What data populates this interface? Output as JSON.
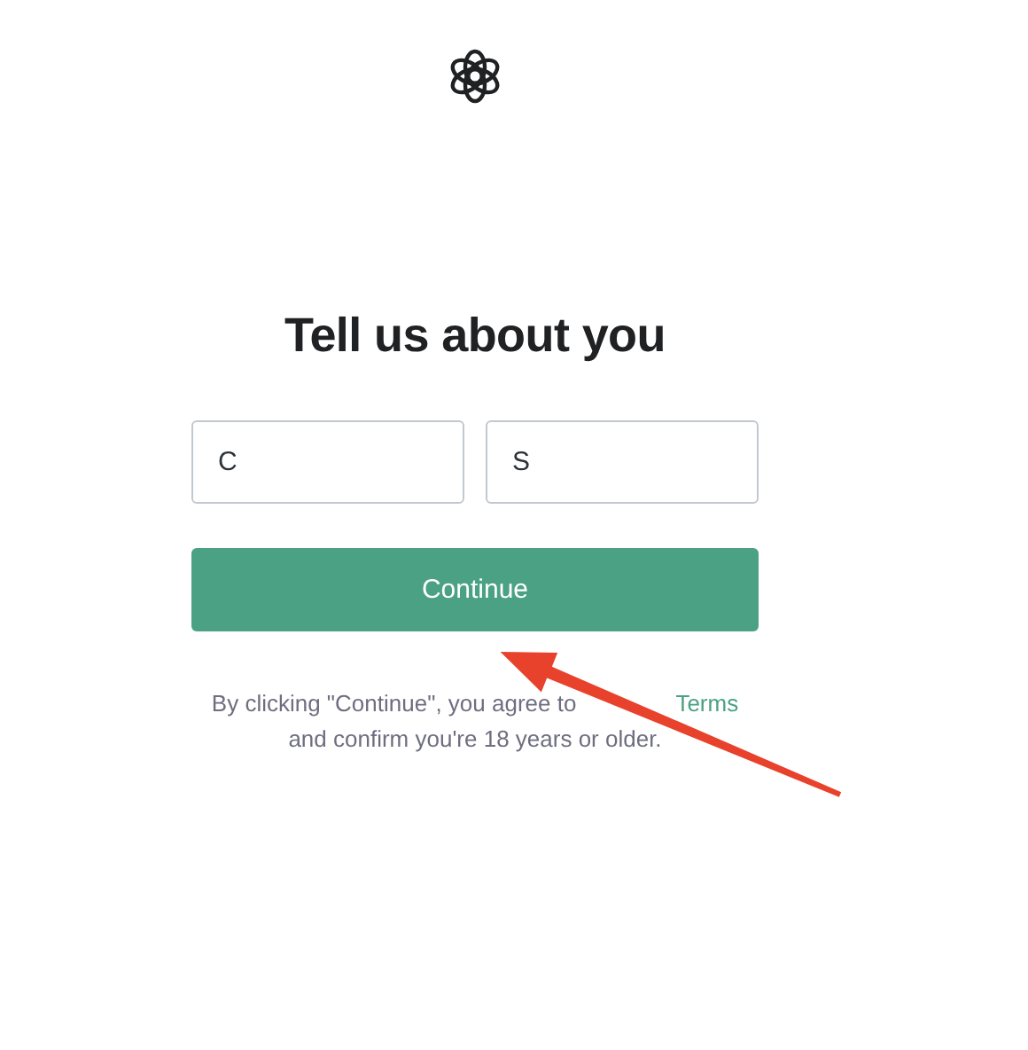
{
  "title": "Tell us about you",
  "fields": [
    {
      "value": "C"
    },
    {
      "value": "S"
    }
  ],
  "button": "Continue",
  "notice": {
    "text": "By clicking \"Continue\", you agree to",
    "link": "Terms",
    "text_after": "and confirm you're 18 years or older."
  }
}
